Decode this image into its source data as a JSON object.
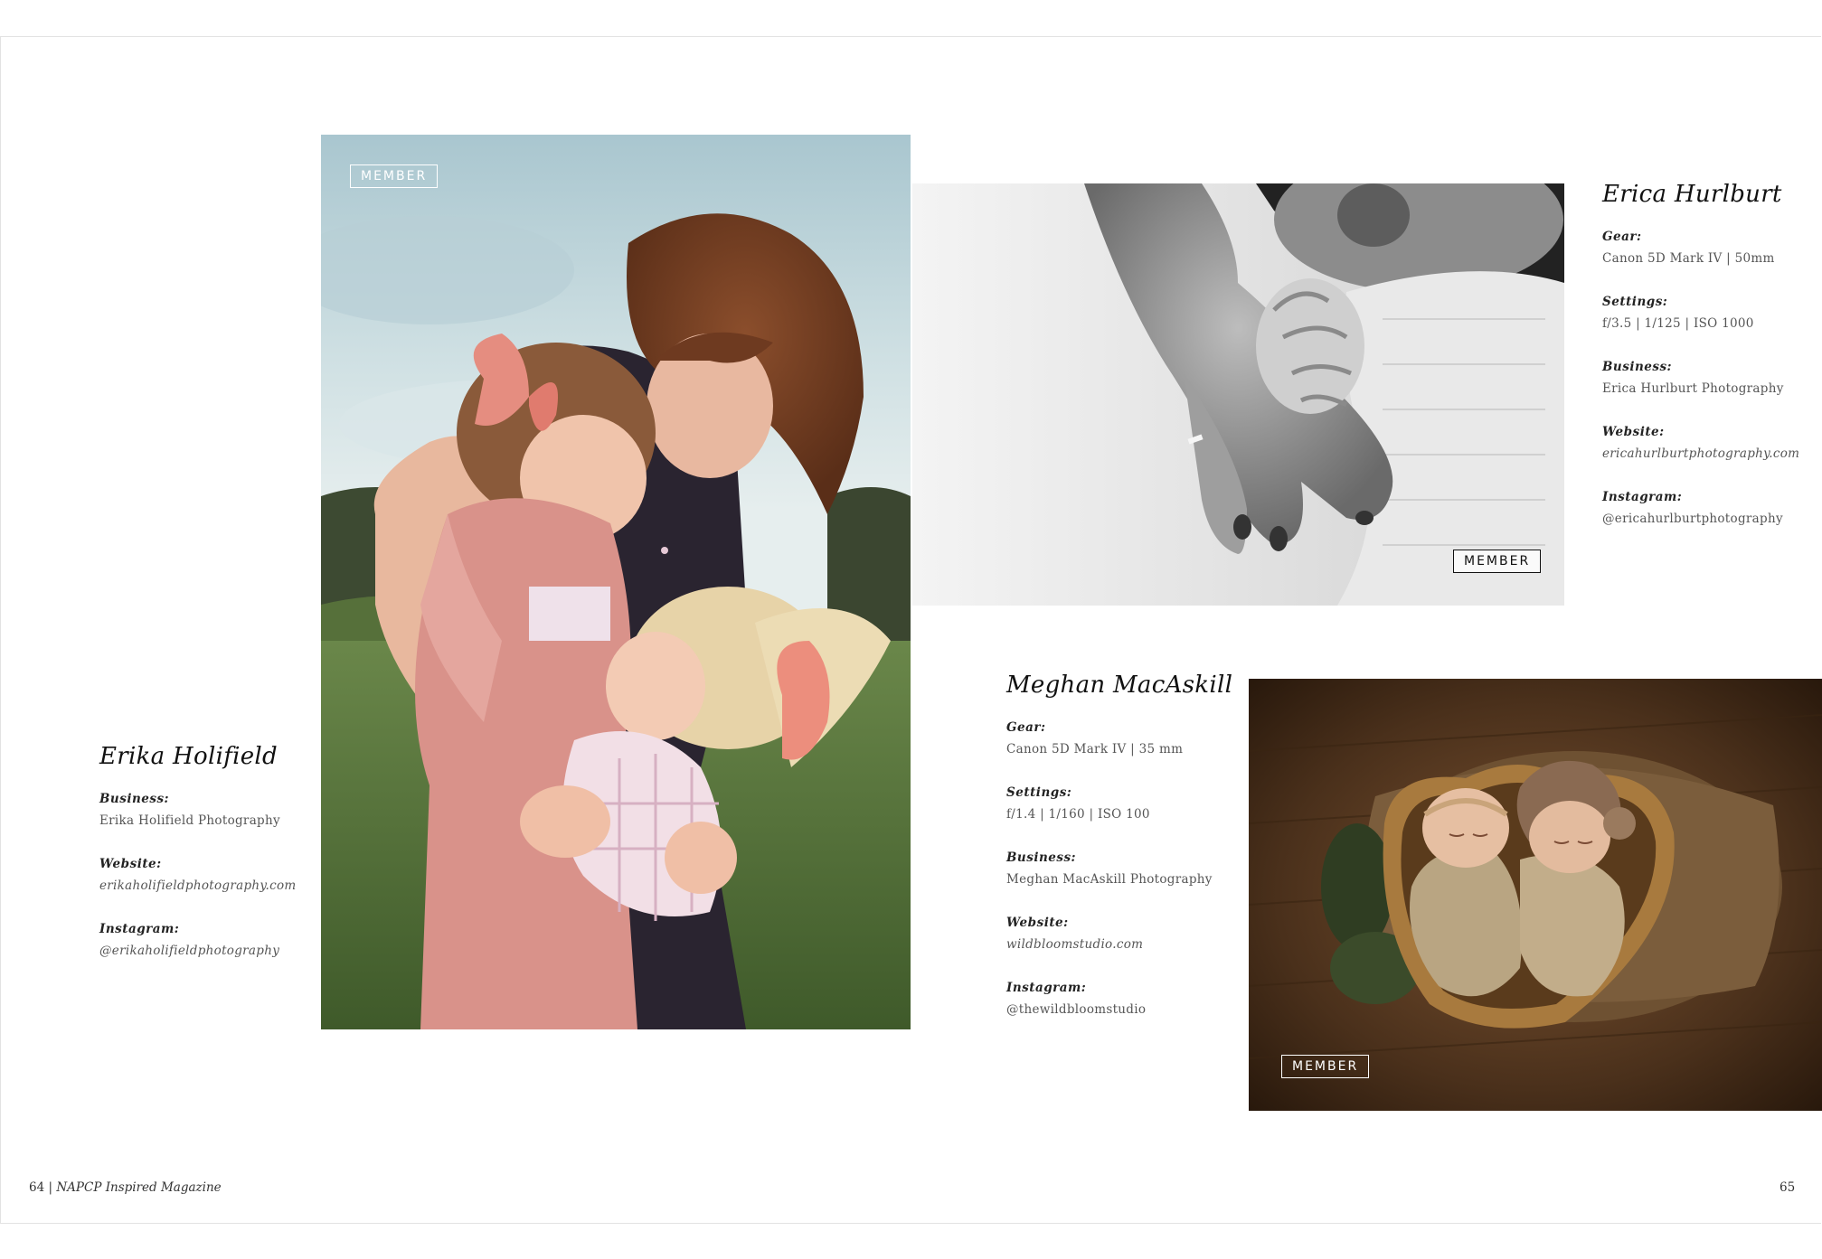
{
  "badge_label": "MEMBER",
  "left_profile": {
    "name": "Erika Holifield",
    "fields": [
      {
        "label": "Business:",
        "value": "Erika Holifield Photography"
      },
      {
        "label": "Website:",
        "value": "erikaholifieldphotography.com"
      },
      {
        "label": "Instagram:",
        "value": "@erikaholifieldphotography"
      }
    ]
  },
  "top_right_profile": {
    "name": "Erica Hurlburt",
    "fields": [
      {
        "label": "Gear:",
        "value": "Canon 5D Mark IV  |  50mm"
      },
      {
        "label": "Settings:",
        "value": "f/3.5  |  1/125  |  ISO 1000"
      },
      {
        "label": "Business:",
        "value": "Erica Hurlburt Photography"
      },
      {
        "label": "Website:",
        "value": "ericahurlburtphotography.com"
      },
      {
        "label": "Instagram:",
        "value": "@ericahurlburtphotography"
      }
    ]
  },
  "middle_profile": {
    "name": "Meghan MacAskill",
    "fields": [
      {
        "label": "Gear:",
        "value": "Canon 5D Mark IV  |  35 mm"
      },
      {
        "label": "Settings:",
        "value": "f/1.4  |  1/160  |  ISO 100"
      },
      {
        "label": "Business:",
        "value": "Meghan MacAskill Photography"
      },
      {
        "label": "Website:",
        "value": "wildbloomstudio.com"
      },
      {
        "label": "Instagram:",
        "value": "@thewildbloomstudio"
      }
    ]
  },
  "footer": {
    "left_page_number": "64",
    "separator": "|",
    "magazine": "NAPCP Inspired Magazine",
    "right_page_number": "65"
  }
}
